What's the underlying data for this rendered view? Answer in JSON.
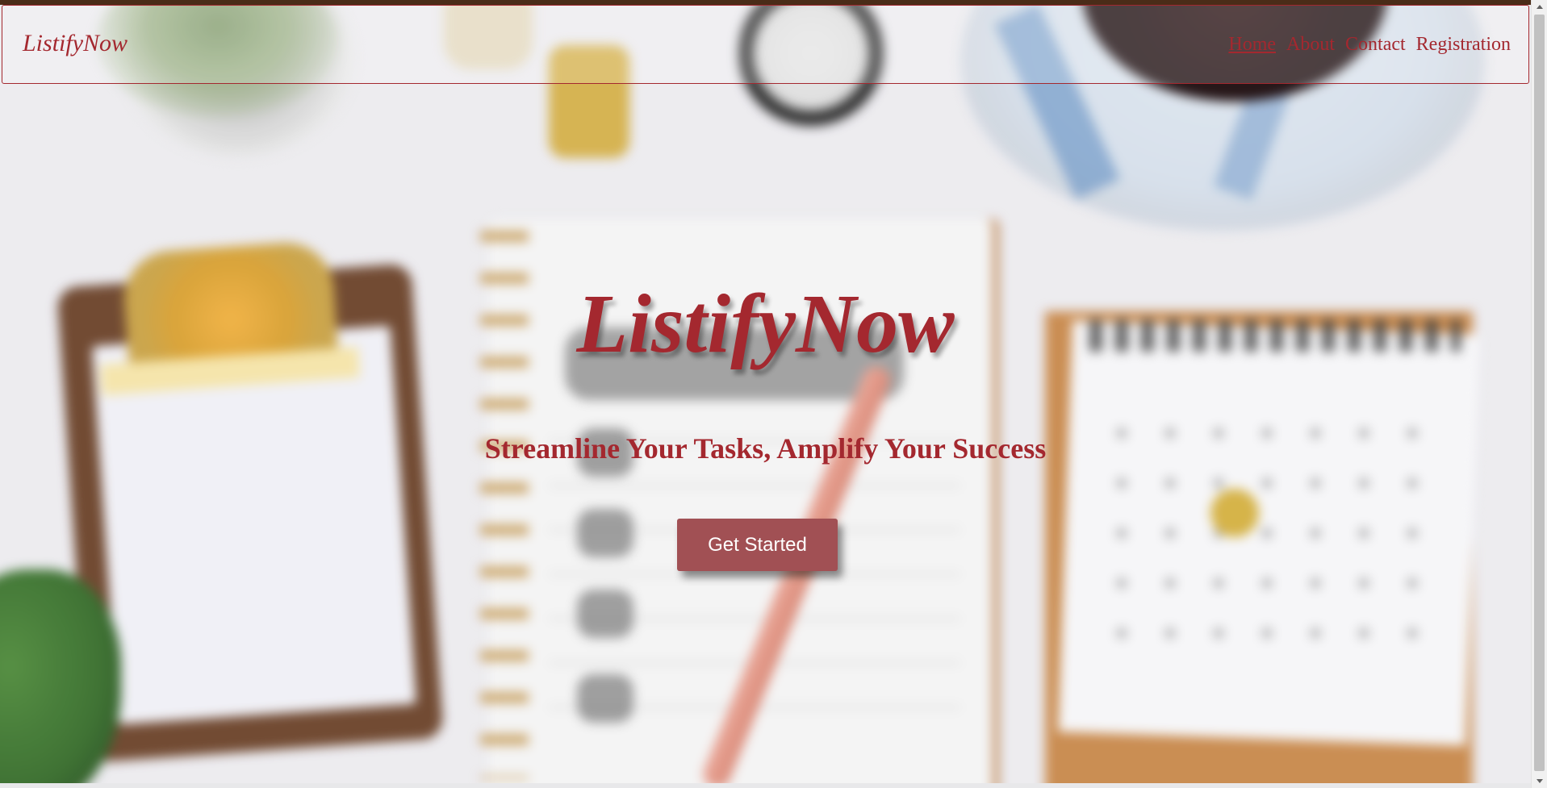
{
  "navbar": {
    "brand": "ListifyNow",
    "links": [
      {
        "label": "Home",
        "active": true
      },
      {
        "label": "About",
        "active": false
      },
      {
        "label": "Contact",
        "active": false
      },
      {
        "label": "Registration",
        "active": false
      }
    ]
  },
  "hero": {
    "title": "ListifyNow",
    "subtitle": "Streamline Your Tasks, Amplify Your Success",
    "cta_label": "Get Started"
  },
  "colors": {
    "accent": "#a4282f",
    "button_bg": "#a15054",
    "button_text": "#ffffff"
  },
  "icons": {
    "scroll_up": "scroll-up-arrow-icon",
    "scroll_down": "scroll-down-arrow-icon"
  }
}
